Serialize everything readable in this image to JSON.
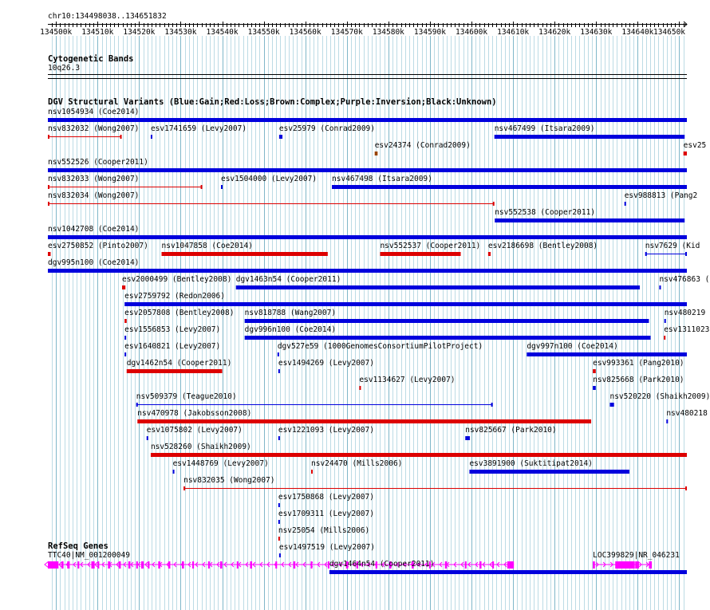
{
  "region": {
    "label": "chr10:134498038..134651832",
    "start": 134498038,
    "end": 134651832
  },
  "ruler": {
    "ticks": [
      "134500k",
      "134510k",
      "134520k",
      "134530k",
      "134540k",
      "134550k",
      "134560k",
      "134570k",
      "134580k",
      "134590k",
      "134600k",
      "134610k",
      "134620k",
      "134630k",
      "134640k",
      "134650k"
    ]
  },
  "cyto": {
    "title": "Cytogenetic Bands",
    "band": "10q26.3"
  },
  "dgv": {
    "title": "DGV Structural Variants (Blue:Gain;Red:Loss;Brown:Complex;Purple:Inversion;Black:Unknown)",
    "colors": {
      "gain": "#0000dd",
      "loss": "#dd0000",
      "complex": "#994400",
      "inversion": "#9900aa",
      "unknown": "#000000"
    },
    "features": [
      {
        "name": "nsv1054934 (Coe2014)",
        "type": "gain",
        "style": "bar",
        "start": 134498038,
        "end": 134651832
      },
      {
        "name": "nsv832032 (Wong2007)",
        "type": "loss",
        "style": "line",
        "start": 134498038,
        "end": 134515800
      },
      {
        "name": "esv1741659 (Levy2007)",
        "type": "gain",
        "style": "bar",
        "start": 134522800,
        "end": 134523100
      },
      {
        "name": "esv25979 (Conrad2009)",
        "type": "gain",
        "style": "bar",
        "start": 134553700,
        "end": 134554500
      },
      {
        "name": "esv24374 (Conrad2009)",
        "type": "complex",
        "style": "bar",
        "start": 134576700,
        "end": 134577400
      },
      {
        "name": "nsv467499 (Itsara2009)",
        "type": "gain",
        "style": "bar",
        "start": 134605500,
        "end": 134651300
      },
      {
        "name": "esv25",
        "type": "loss",
        "style": "bar",
        "start": 134651000,
        "end": 134651832
      },
      {
        "name": "nsv552526 (Cooper2011)",
        "type": "gain",
        "style": "bar",
        "start": 134498038,
        "end": 134651832
      },
      {
        "name": "nsv832033 (Wong2007)",
        "type": "loss",
        "style": "line",
        "start": 134498038,
        "end": 134535200
      },
      {
        "name": "esv1504000 (Levy2007)",
        "type": "gain",
        "style": "bar",
        "start": 134539700,
        "end": 134540000
      },
      {
        "name": "nsv467498 (Itsara2009)",
        "type": "gain",
        "style": "bar",
        "start": 134566400,
        "end": 134651832
      },
      {
        "name": "nsv832034 (Wong2007)",
        "type": "loss",
        "style": "line",
        "start": 134498038,
        "end": 134605500
      },
      {
        "name": "nsv552538 (Cooper2011)",
        "type": "gain",
        "style": "bar",
        "start": 134605600,
        "end": 134651300
      },
      {
        "name": "nsv1042708 (Coe2014)",
        "type": "gain",
        "style": "bar",
        "start": 134498038,
        "end": 134651832
      },
      {
        "name": "esv2750852 (Pinto2007)",
        "type": "loss",
        "style": "bar",
        "start": 134498038,
        "end": 134498700
      },
      {
        "name": "nsv1047858 (Coe2014)",
        "type": "loss",
        "style": "bar",
        "start": 134525400,
        "end": 134565400
      },
      {
        "name": "nsv552537 (Cooper2011)",
        "type": "loss",
        "style": "bar",
        "start": 134578000,
        "end": 134597400
      },
      {
        "name": "esv2186698 (Bentley2008)",
        "type": "loss",
        "style": "bar",
        "start": 134604000,
        "end": 134604600
      },
      {
        "name": "esv988813 (Pang2",
        "type": "gain",
        "style": "bar",
        "start": 134636800,
        "end": 134637100
      },
      {
        "name": "dgv995n100 (Coe2014)",
        "type": "gain",
        "style": "bar",
        "start": 134498038,
        "end": 134651832
      },
      {
        "name": "esv2000499 (Bentley2008)",
        "type": "loss",
        "style": "bar",
        "start": 134515900,
        "end": 134516700
      },
      {
        "name": "dgv1463n54 (Cooper2011)",
        "type": "gain",
        "style": "bar",
        "start": 134543300,
        "end": 134640500
      },
      {
        "name": "nsv7629 (Kid",
        "type": "gain",
        "style": "line",
        "start": 134641800,
        "end": 134651832
      },
      {
        "name": "esv2759792 (Redon2006)",
        "type": "gain",
        "style": "bar",
        "start": 134516500,
        "end": 134651832
      },
      {
        "name": "esv2057808 (Bentley2008)",
        "type": "loss",
        "style": "bar",
        "start": 134516500,
        "end": 134517000
      },
      {
        "name": "nsv818788 (Wang2007)",
        "type": "gain",
        "style": "bar",
        "start": 134545400,
        "end": 134642700
      },
      {
        "name": "nsv476863 (",
        "type": "gain",
        "style": "bar",
        "start": 134645200,
        "end": 134645500
      },
      {
        "name": "esv1556853 (Levy2007)",
        "type": "gain",
        "style": "bar",
        "start": 134516500,
        "end": 134516800
      },
      {
        "name": "dgv996n100 (Coe2014)",
        "type": "gain",
        "style": "bar",
        "start": 134545400,
        "end": 134643100
      },
      {
        "name": "nsv480219",
        "type": "gain",
        "style": "bar",
        "start": 134646400,
        "end": 134646700
      },
      {
        "name": "esv1640821 (Levy2007)",
        "type": "gain",
        "style": "bar",
        "start": 134516500,
        "end": 134516800
      },
      {
        "name": "dgv527e59 (1000GenomesConsortiumPilotProject)",
        "type": "gain",
        "style": "bar",
        "start": 134553300,
        "end": 134553600
      },
      {
        "name": "dgv997n100 (Coe2014)",
        "type": "gain",
        "style": "bar",
        "start": 134613300,
        "end": 134651832
      },
      {
        "name": "dgv1462n54 (Cooper2011)",
        "type": "loss",
        "style": "bar",
        "start": 134517000,
        "end": 134540000
      },
      {
        "name": "esv1494269 (Levy2007)",
        "type": "gain",
        "style": "bar",
        "start": 134553500,
        "end": 134553800
      },
      {
        "name": "esv1134627 (Levy2007)",
        "type": "loss",
        "style": "bar",
        "start": 134573000,
        "end": 134573300
      },
      {
        "name": "esv993361 (Pang2010)",
        "type": "loss",
        "style": "bar",
        "start": 134629200,
        "end": 134629900
      },
      {
        "name": "nsv509379 (Teague2010)",
        "type": "gain",
        "style": "line",
        "start": 134519300,
        "end": 134605100
      },
      {
        "name": "nsv825668 (Park2010)",
        "type": "gain",
        "style": "bar",
        "start": 134629200,
        "end": 134629900
      },
      {
        "name": "nsv470978 (Jakobsson2008)",
        "type": "loss",
        "style": "bar",
        "start": 134519600,
        "end": 134628800
      },
      {
        "name": "nsv520220 (Shaikh2009)",
        "type": "gain",
        "style": "bar",
        "start": 134633300,
        "end": 134634300
      },
      {
        "name": "esv1075802 (Levy2007)",
        "type": "gain",
        "style": "bar",
        "start": 134521800,
        "end": 134522100
      },
      {
        "name": "esv1221093 (Levy2007)",
        "type": "gain",
        "style": "bar",
        "start": 134553500,
        "end": 134553800
      },
      {
        "name": "nsv825667 (Park2010)",
        "type": "gain",
        "style": "bar",
        "start": 134598500,
        "end": 134599600
      },
      {
        "name": "esv1311023",
        "type": "loss",
        "style": "bar",
        "start": 134646300,
        "end": 134646600
      },
      {
        "name": "nsv528260 (Shaikh2009)",
        "type": "loss",
        "style": "bar",
        "start": 134522800,
        "end": 134651832
      },
      {
        "name": "esv1448769 (Levy2007)",
        "type": "gain",
        "style": "bar",
        "start": 134528100,
        "end": 134528400
      },
      {
        "name": "nsv24470 (Mills2006)",
        "type": "loss",
        "style": "bar",
        "start": 134561400,
        "end": 134561700
      },
      {
        "name": "esv3891900 (Suktitipat2014)",
        "type": "gain",
        "style": "bar",
        "start": 134599500,
        "end": 134638000
      },
      {
        "name": "nsv480218",
        "type": "gain",
        "style": "bar",
        "start": 134646900,
        "end": 134647200
      },
      {
        "name": "nsv832035 (Wong2007)",
        "type": "loss",
        "style": "line",
        "start": 134530700,
        "end": 134651832
      },
      {
        "name": "esv1750868 (Levy2007)",
        "type": "gain",
        "style": "bar",
        "start": 134553500,
        "end": 134553800
      },
      {
        "name": "esv1709311 (Levy2007)",
        "type": "gain",
        "style": "bar",
        "start": 134553500,
        "end": 134553800
      },
      {
        "name": "nsv25054 (Mills2006)",
        "type": "loss",
        "style": "bar",
        "start": 134553500,
        "end": 134553800
      },
      {
        "name": "esv1497519 (Levy2007)",
        "type": "gain",
        "style": "bar",
        "start": 134553700,
        "end": 134554000
      },
      {
        "name": "dgv1464n54 (Cooper2011)",
        "type": "gain",
        "style": "bar",
        "start": 134565800,
        "end": 134651832
      }
    ]
  },
  "refseq": {
    "title": "RefSeq Genes",
    "color": "#ff00ff",
    "genes": [
      {
        "name": "TTC40|NM_001200049",
        "start": 134498038,
        "end": 134610200,
        "strand": "-",
        "exons": [
          [
            134498038,
            134500600
          ],
          [
            134501300,
            134501800
          ],
          [
            134502700,
            134503300
          ],
          [
            134505200,
            134505600
          ],
          [
            134508500,
            134509300
          ],
          [
            134510000,
            134510400
          ],
          [
            134512500,
            134513000
          ],
          [
            134515100,
            134515600
          ],
          [
            134517400,
            134517900
          ],
          [
            134519300,
            134519700
          ],
          [
            134520500,
            134521100
          ],
          [
            134522100,
            134522500
          ],
          [
            134524600,
            134525100
          ],
          [
            134527000,
            134527500
          ],
          [
            134530300,
            134530800
          ],
          [
            134532800,
            134533200
          ],
          [
            134536600,
            134537000
          ],
          [
            134539500,
            134540000
          ],
          [
            134543500,
            134543900
          ],
          [
            134546700,
            134547200
          ],
          [
            134552800,
            134553200
          ],
          [
            134557100,
            134557600
          ],
          [
            134561300,
            134561700
          ],
          [
            134565400,
            134565800
          ],
          [
            134569800,
            134570300
          ],
          [
            134572300,
            134572700
          ],
          [
            134576900,
            134577300
          ],
          [
            134580200,
            134580700
          ],
          [
            134585600,
            134586100
          ],
          [
            134589800,
            134590200
          ],
          [
            134593600,
            134594100
          ],
          [
            134598400,
            134598800
          ],
          [
            134601900,
            134602400
          ],
          [
            134605000,
            134605400
          ],
          [
            134608600,
            134610200
          ]
        ]
      },
      {
        "name": "LOC399829|NR_046231",
        "start": 134629200,
        "end": 134643400,
        "strand": "+",
        "exons": [
          [
            134629200,
            134629700
          ],
          [
            134634600,
            134639300
          ],
          [
            134639400,
            134640300
          ],
          [
            134642700,
            134643400
          ]
        ]
      }
    ]
  }
}
